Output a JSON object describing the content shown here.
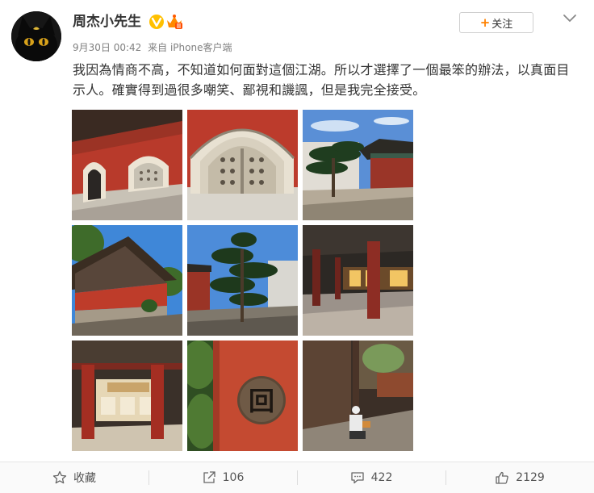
{
  "user": {
    "name": "周杰小先生",
    "date": "9月30日 00:42",
    "source": "来自 iPhone客户端"
  },
  "follow_label": "关注",
  "follow_plus": "+",
  "post_text": "我因為情商不高，不知道如何面對這個江湖。所以才選擇了一個最笨的辦法，以真面目示人。確實得到過很多嘲笑、鄙視和譏諷，但是我完全接受。",
  "photos": [
    "red-wall-arched-windows",
    "carved-stone-window",
    "pavilion-with-pine",
    "red-hall-upward",
    "pine-tree-courtyard",
    "hall-interior-red-pillar",
    "hall-interior-pillars",
    "round-plaque-on-red-door",
    "man-sitting-in-courtyard"
  ],
  "plaque_char": "回",
  "actions": {
    "favorite_label": "收藏",
    "share_count": "106",
    "comment_count": "422",
    "like_count": "2129"
  },
  "colors": {
    "follow_plus": "#ff8200",
    "verified_badge": "#ffc000"
  }
}
